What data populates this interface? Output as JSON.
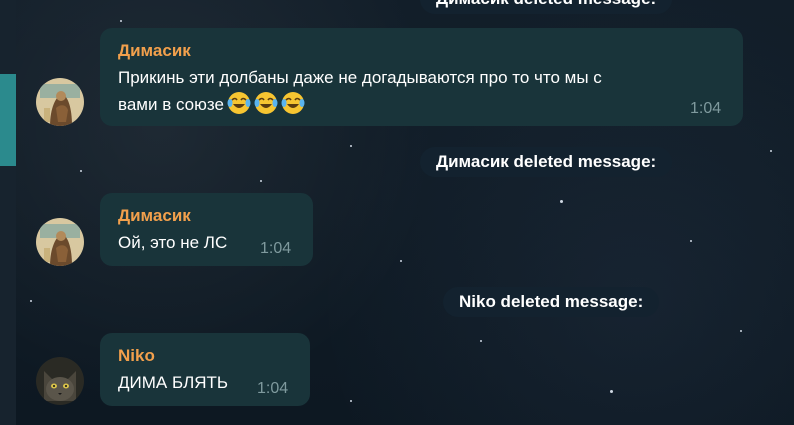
{
  "chat": {
    "service_messages": [
      {
        "text": "Димасик deleted message:"
      },
      {
        "text": "Димасик deleted message:"
      },
      {
        "text": "Niko deleted message:"
      }
    ],
    "messages": [
      {
        "sender": "Димасик",
        "text_line1": "Прикинь эти долбаны даже не догадываются про то что мы с",
        "text_line2": "вами в союзе",
        "emoji": [
          "face-with-tears-of-joy",
          "face-with-tears-of-joy",
          "face-with-tears-of-joy"
        ],
        "time": "1:04",
        "avatar": "dimasik-avatar"
      },
      {
        "sender": "Димасик",
        "text": "Ой, это не ЛС",
        "time": "1:04",
        "avatar": "dimasik-avatar"
      },
      {
        "sender": "Niko",
        "text": "ДИМА БЛЯТЬ",
        "time": "1:04",
        "avatar": "niko-cat-avatar"
      }
    ]
  },
  "colors": {
    "sender_name": "#f2a04c",
    "bubble": "#19343a",
    "accent": "#2b8a8d"
  }
}
